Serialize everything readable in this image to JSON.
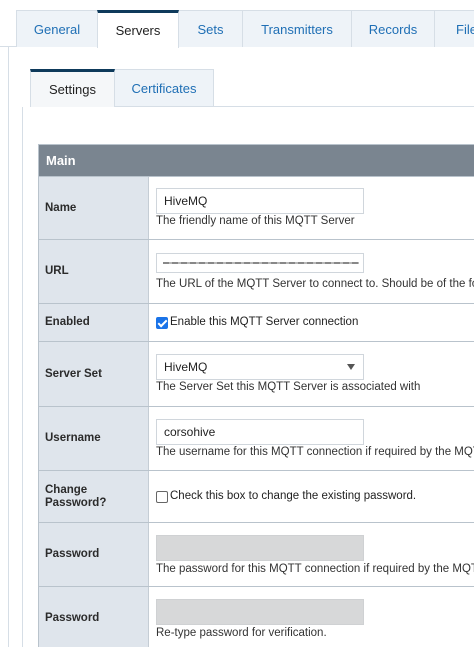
{
  "top_tabs": [
    {
      "label": "General",
      "active": false
    },
    {
      "label": "Servers",
      "active": true
    },
    {
      "label": "Sets",
      "active": false
    },
    {
      "label": "Transmitters",
      "active": false
    },
    {
      "label": "Records",
      "active": false
    },
    {
      "label": "File",
      "active": false
    }
  ],
  "inner_tabs": [
    {
      "label": "Settings",
      "active": true
    },
    {
      "label": "Certificates",
      "active": false
    }
  ],
  "form": {
    "section_title": "Main",
    "name": {
      "label": "Name",
      "value": "HiveMQ",
      "help": "The friendly name of this MQTT Server"
    },
    "url": {
      "label": "URL",
      "value": "",
      "help": "The URL of the MQTT Server to connect to. Should be of the format"
    },
    "enabled": {
      "label": "Enabled",
      "checked": true,
      "checkbox_label": "Enable this MQTT Server connection"
    },
    "server_set": {
      "label": "Server Set",
      "value": "HiveMQ",
      "help": "The Server Set this MQTT Server is associated with"
    },
    "username": {
      "label": "Username",
      "value": "corsohive",
      "help": "The username for this MQTT connection if required by the MQTT"
    },
    "change_password": {
      "label": "Change Password?",
      "checked": false,
      "checkbox_label": "Check this box to change the existing password."
    },
    "password": {
      "label": "Password",
      "value": "",
      "help": "The password for this MQTT connection if required by the MQTT"
    },
    "password_confirm": {
      "label": "Password",
      "value": "",
      "help": "Re-type password for verification."
    }
  },
  "colors": {
    "accent": "#0e3a5b",
    "link": "#1f6fb5",
    "section_header": "#7a8590",
    "label_bg": "#dfe5ec"
  }
}
